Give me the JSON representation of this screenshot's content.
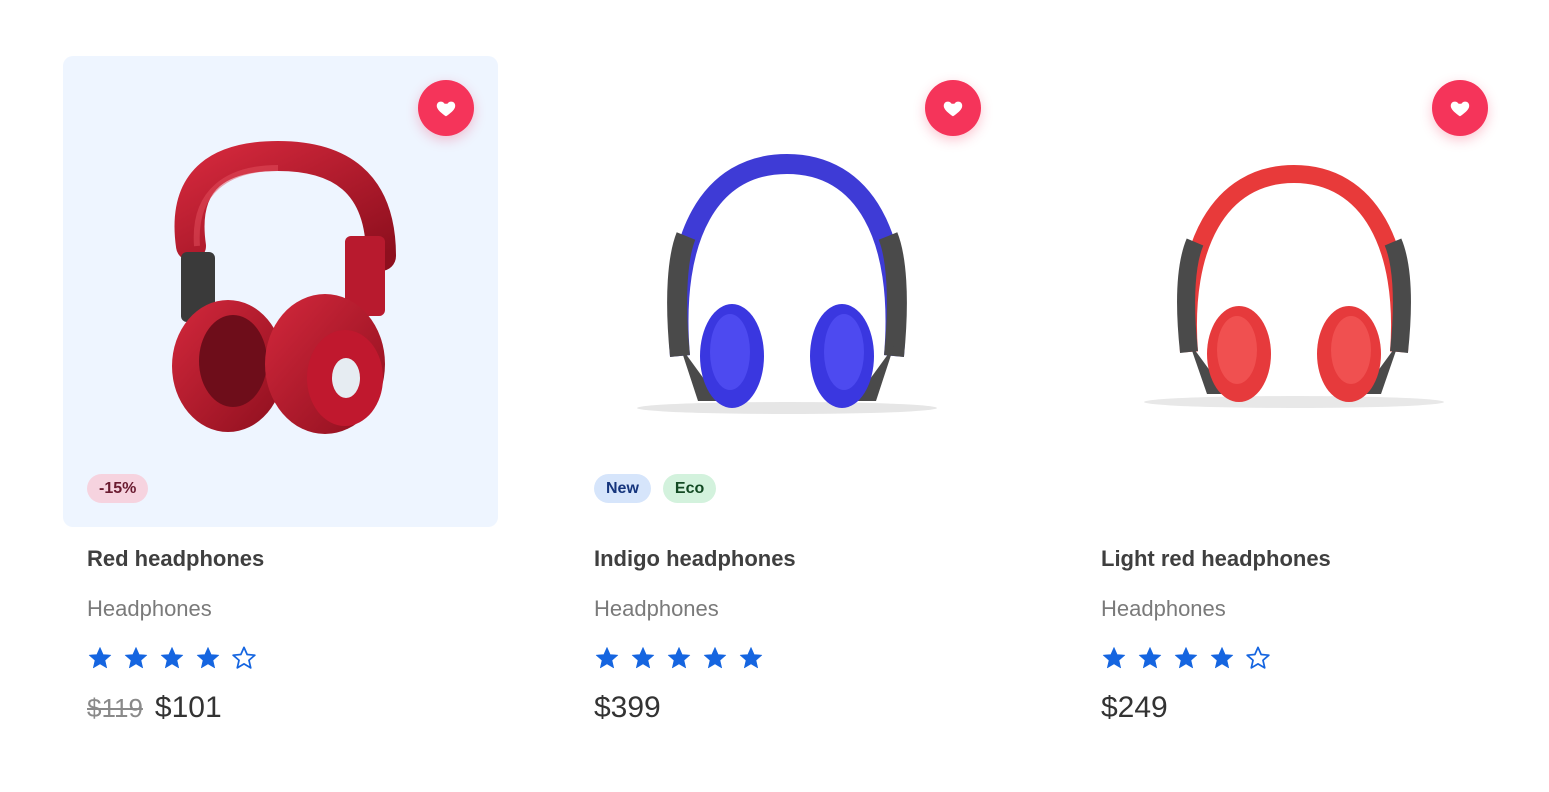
{
  "colors": {
    "accent": "#f5345a",
    "star": "#1565e0",
    "active_card_bg": "#eef5ff"
  },
  "products": [
    {
      "name": "Red headphones",
      "category": "Headphones",
      "rating": 4,
      "rating_max": 5,
      "badges": [
        {
          "label": "-15%",
          "kind": "discount"
        }
      ],
      "old_price": "$119",
      "price": "$101",
      "favorite_icon": "heart-icon",
      "image": "red-headphones-side-view"
    },
    {
      "name": "Indigo headphones",
      "category": "Headphones",
      "rating": 5,
      "rating_max": 5,
      "badges": [
        {
          "label": "New",
          "kind": "new"
        },
        {
          "label": "Eco",
          "kind": "eco"
        }
      ],
      "old_price": "",
      "price": "$399",
      "favorite_icon": "heart-icon",
      "image": "indigo-headphones-front-view"
    },
    {
      "name": "Light red headphones",
      "category": "Headphones",
      "rating": 4,
      "rating_max": 5,
      "badges": [],
      "old_price": "",
      "price": "$249",
      "favorite_icon": "heart-icon",
      "image": "light-red-headphones-front-view"
    }
  ]
}
